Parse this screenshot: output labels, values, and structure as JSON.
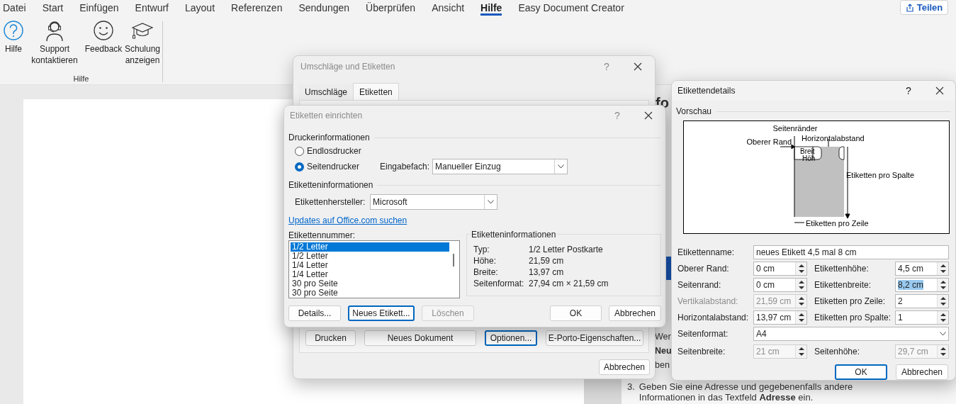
{
  "menu_tabs": [
    {
      "label": "Datei",
      "selected": false
    },
    {
      "label": "Start",
      "selected": false
    },
    {
      "label": "Einfügen",
      "selected": false
    },
    {
      "label": "Entwurf",
      "selected": false
    },
    {
      "label": "Layout",
      "selected": false
    },
    {
      "label": "Referenzen",
      "selected": false
    },
    {
      "label": "Sendungen",
      "selected": false
    },
    {
      "label": "Überprüfen",
      "selected": false
    },
    {
      "label": "Ansicht",
      "selected": false
    },
    {
      "label": "Hilfe",
      "selected": true
    },
    {
      "label": "Easy Document Creator",
      "selected": false
    }
  ],
  "share_button": "Teilen",
  "ribbon": {
    "buttons": [
      {
        "kind": "help",
        "label": "Hilfe"
      },
      {
        "kind": "support",
        "label": "Support kontaktieren"
      },
      {
        "kind": "feedback",
        "label": "Feedback"
      },
      {
        "kind": "training",
        "label": "Schulung anzeigen"
      }
    ],
    "group_label": "Hilfe"
  },
  "help_pane": {
    "fragments": [
      {
        "kind": "heading",
        "text": "fo"
      },
      {
        "kind": "button"
      },
      {
        "kind": "text",
        "text": "Wer"
      },
      {
        "kind": "bold",
        "text": "Neu"
      },
      {
        "kind": "text",
        "text": "ben"
      }
    ],
    "step_number": "3.",
    "step_lines": [
      "Geben Sie eine Adresse und gegebenenfalls andere",
      "Informationen in das Textfeld **Adresse** ein."
    ]
  },
  "envelopes_dialog": {
    "title": "Umschläge und Etiketten",
    "help": "?",
    "tabs": [
      {
        "label": "Umschläge",
        "selected": false
      },
      {
        "label": "Etiketten",
        "selected": true
      }
    ],
    "buttons": [
      {
        "label": "Drucken",
        "focused": false
      },
      {
        "label": "Neues Dokument",
        "focused": false
      },
      {
        "label": "Optionen...",
        "focused": true
      },
      {
        "label": "E-Porto-Eigenschaften...",
        "focused": false
      }
    ],
    "cancel": "Abbrechen"
  },
  "label_setup_dialog": {
    "title": "Etiketten einrichten",
    "help": "?",
    "printer_section": "Druckerinformationen",
    "printers": [
      {
        "label": "Endlosdrucker",
        "selected": false
      },
      {
        "label": "Seitendrucker",
        "selected": true
      }
    ],
    "tray": {
      "label": "Eingabefach:",
      "value": "Manueller Einzug"
    },
    "label_section": "Etiketteninformationen",
    "vendor": {
      "label": "Etikettenhersteller:",
      "value": "Microsoft"
    },
    "updates_link": "Updates auf Office.com suchen",
    "number_label": "Etikettennummer:",
    "numbers": [
      {
        "label": "1/2 Letter",
        "selected": true
      },
      {
        "label": "1/2 Letter",
        "selected": false
      },
      {
        "label": "1/4 Letter",
        "selected": false
      },
      {
        "label": "1/4 Letter",
        "selected": false
      },
      {
        "label": "30 pro Seite",
        "selected": false
      },
      {
        "label": "30 pro Seite",
        "selected": false
      }
    ],
    "info": {
      "title": "Etiketteninformationen",
      "rows": [
        {
          "key": "Typ:",
          "value": "1/2 Letter Postkarte"
        },
        {
          "key": "Höhe:",
          "value": "21,59 cm"
        },
        {
          "key": "Breite:",
          "value": "13,97 cm"
        },
        {
          "key": "Seitenformat:",
          "value": "27,94 cm × 21,59 cm"
        }
      ]
    },
    "buttons": [
      {
        "label": "Details...",
        "focused": false,
        "disabled": false
      },
      {
        "label": "Neues Etikett...",
        "focused": true,
        "disabled": false
      },
      {
        "label": "Löschen",
        "focused": false,
        "disabled": true
      }
    ],
    "ok": "OK",
    "cancel": "Abbrechen"
  },
  "details_dialog": {
    "title": "Etikettendetails",
    "help": "?",
    "preview_label": "Vorschau",
    "diagram": {
      "margins": "Seitenränder",
      "horizontal_pitch": "Horizontalabstand",
      "top_margin": "Oberer Rand",
      "width": "Breit",
      "height": "Höh",
      "per_column": "Etiketten pro Spalte",
      "per_row": "Etiketten pro Zeile"
    },
    "name": {
      "label": "Etikettenname:",
      "value": "neues Etikett 4,5 mal 8 cm"
    },
    "fields": [
      {
        "label": "Oberer Rand:",
        "value": "0 cm",
        "disabled": false,
        "label_dimmed": false,
        "text_selected": false
      },
      {
        "label": "Etikettenhöhe:",
        "value": "4,5 cm",
        "disabled": false,
        "label_dimmed": false,
        "text_selected": false
      },
      {
        "label": "Seitenrand:",
        "value": "0 cm",
        "disabled": false,
        "label_dimmed": false,
        "text_selected": false
      },
      {
        "label": "Etikettenbreite:",
        "value": "8,2 cm",
        "disabled": false,
        "label_dimmed": false,
        "text_selected": true
      },
      {
        "label": "Vertikalabstand:",
        "value": "21,59 cm",
        "disabled": true,
        "label_dimmed": true,
        "text_selected": false
      },
      {
        "label": "Etiketten pro Zeile:",
        "value": "2",
        "disabled": false,
        "label_dimmed": false,
        "text_selected": false
      },
      {
        "label": "Horizontalabstand:",
        "value": "13,97 cm",
        "disabled": false,
        "label_dimmed": false,
        "text_selected": false
      },
      {
        "label": "Etiketten pro Spalte:",
        "value": "1",
        "disabled": false,
        "label_dimmed": false,
        "text_selected": false
      }
    ],
    "page_format": {
      "label": "Seitenformat:",
      "value": "A4"
    },
    "page_fields": [
      {
        "label": "Seitenbreite:",
        "value": "21 cm",
        "disabled": true,
        "label_dimmed": false,
        "text_selected": false
      },
      {
        "label": "Seitenhöhe:",
        "value": "29,7 cm",
        "disabled": true,
        "label_dimmed": false,
        "text_selected": false
      }
    ],
    "ok": "OK",
    "cancel": "Abbrechen"
  }
}
